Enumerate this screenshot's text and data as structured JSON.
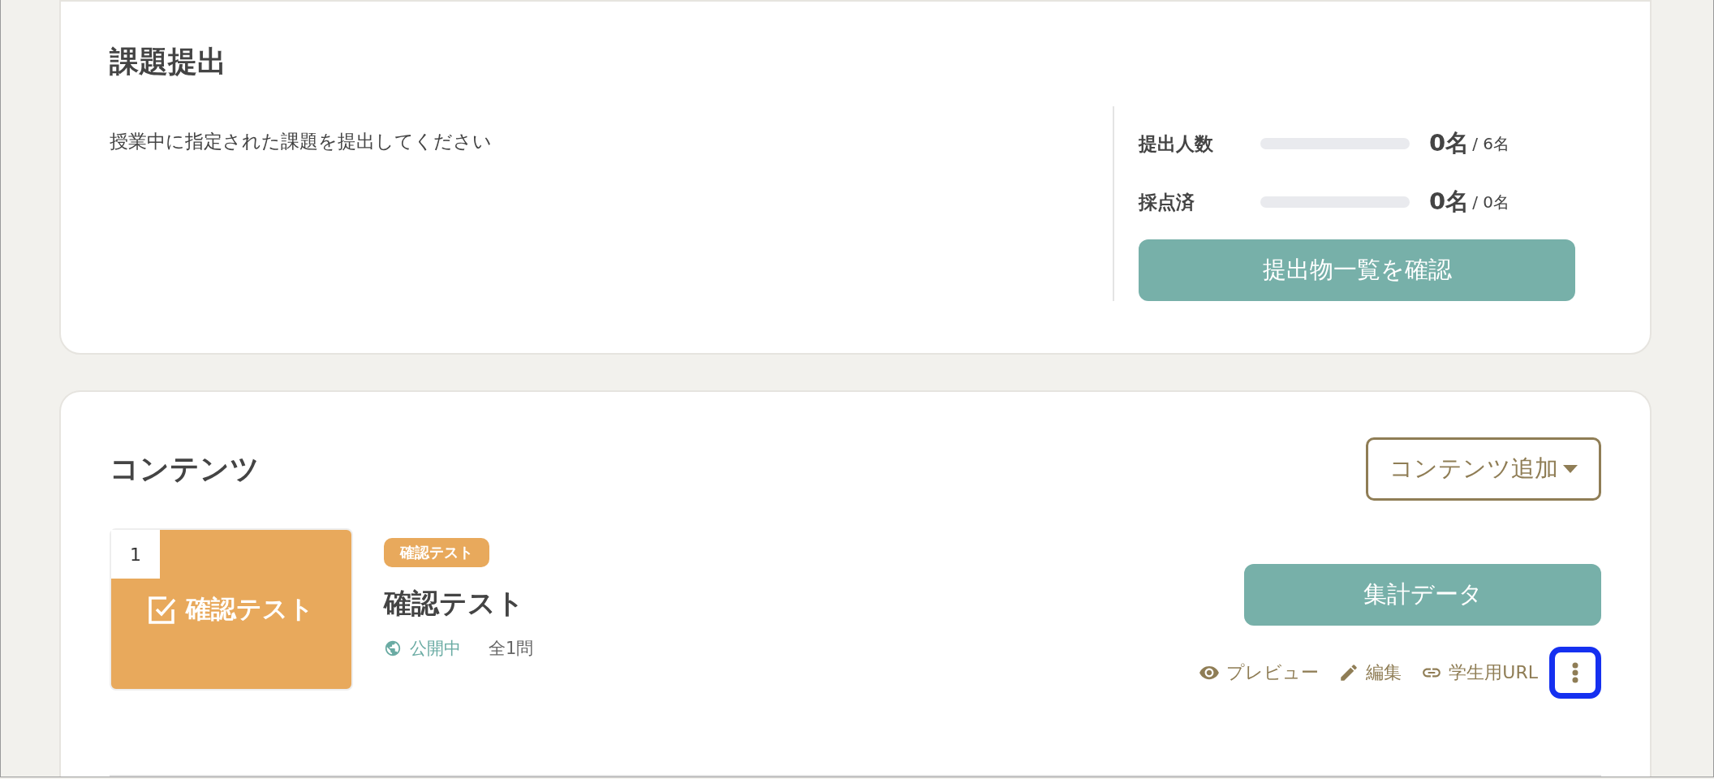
{
  "assignment": {
    "title": "課題提出",
    "description": "授業中に指定された課題を提出してください",
    "stats": [
      {
        "label": "提出人数",
        "level": 0,
        "count": "0名",
        "total": "/ 6名"
      },
      {
        "label": "採点済",
        "level": 0,
        "count": "0名",
        "total": "/ 0名"
      }
    ],
    "button": "提出物一覧を確認"
  },
  "contents": {
    "title": "コンテンツ",
    "add_button": "コンテンツ追加",
    "items": [
      {
        "number": "1",
        "thumbnail_label": "確認テスト",
        "badge": "確認テスト",
        "title": "確認テスト",
        "status": "公開中",
        "published": true,
        "question_count": "全1問",
        "summary_button": "集計データ",
        "actions": [
          {
            "kind": "preview",
            "label": "プレビュー"
          },
          {
            "kind": "edit",
            "label": "編集"
          },
          {
            "kind": "link",
            "label": "学生用URL"
          }
        ],
        "menu_highlighted": true
      }
    ]
  }
}
